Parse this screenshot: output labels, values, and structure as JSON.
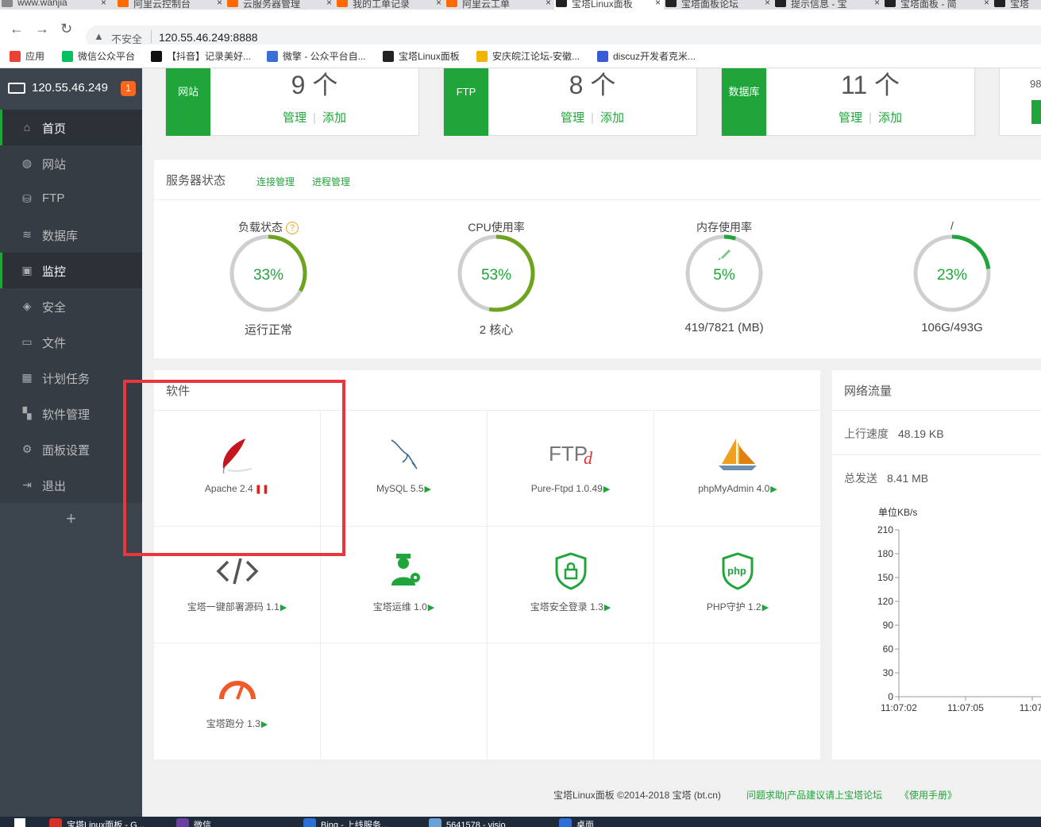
{
  "browser": {
    "tabs": [
      {
        "label": "www.wanjia",
        "close": "×",
        "active": false,
        "color": "#888888"
      },
      {
        "label": "阿里云控制台",
        "close": "×",
        "active": false,
        "color": "#ff6a00"
      },
      {
        "label": "云服务器管理",
        "close": "×",
        "active": false,
        "color": "#ff6a00"
      },
      {
        "label": "我的工单记录",
        "close": "×",
        "active": false,
        "color": "#ff6a00"
      },
      {
        "label": "阿里云工单",
        "close": "×",
        "active": false,
        "color": "#ff6a00"
      },
      {
        "label": "宝塔Linux面板",
        "close": "×",
        "active": true,
        "color": "#222222"
      },
      {
        "label": "宝塔面板论坛",
        "close": "×",
        "active": false,
        "color": "#222222"
      },
      {
        "label": "提示信息 - 宝",
        "close": "×",
        "active": false,
        "color": "#222222"
      },
      {
        "label": "宝塔面板 - 简",
        "close": "×",
        "active": false,
        "color": "#222222"
      },
      {
        "label": "宝塔",
        "close": "",
        "active": false,
        "color": "#222222"
      }
    ],
    "nav": {
      "back": "←",
      "forward": "→",
      "reload": "↻"
    },
    "address": {
      "warning_icon": "▲",
      "insecure": "不安全",
      "url": "120.55.46.249:8888"
    },
    "bookmarks": [
      {
        "label": "应用",
        "color": "#ea4335"
      },
      {
        "label": "微信公众平台",
        "color": "#07c160"
      },
      {
        "label": "【抖音】记录美好...",
        "color": "#111111"
      },
      {
        "label": "微擎 - 公众平台自...",
        "color": "#3a6fd8"
      },
      {
        "label": "宝塔Linux面板",
        "color": "#222222"
      },
      {
        "label": "安庆皖江论坛-安徽...",
        "color": "#f3b400"
      },
      {
        "label": "discuz开发者克米...",
        "color": "#3a5bd8"
      }
    ]
  },
  "sidebar": {
    "ip": "120.55.46.249",
    "badge": "1",
    "items": [
      {
        "label": "首页",
        "icon": "⌂",
        "active": true
      },
      {
        "label": "网站",
        "icon": "◍",
        "active": false
      },
      {
        "label": "FTP",
        "icon": "⛁",
        "active": false
      },
      {
        "label": "数据库",
        "icon": "≋",
        "active": false
      },
      {
        "label": "监控",
        "icon": "▣",
        "active": false,
        "current": true
      },
      {
        "label": "安全",
        "icon": "◈",
        "active": false
      },
      {
        "label": "文件",
        "icon": "▭",
        "active": false
      },
      {
        "label": "计划任务",
        "icon": "▦",
        "active": false
      },
      {
        "label": "软件管理",
        "icon": "▚",
        "active": false
      },
      {
        "label": "面板设置",
        "icon": "⚙",
        "active": false
      },
      {
        "label": "退出",
        "icon": "⇥",
        "active": false
      }
    ],
    "plus": "+"
  },
  "stats": [
    {
      "label": "网站",
      "value": "9 个",
      "manage": "管理",
      "add": "添加"
    },
    {
      "label": "FTP",
      "value": "8 个",
      "manage": "管理",
      "add": "添加"
    },
    {
      "label": "数据库",
      "value": "11 个",
      "manage": "管理",
      "add": "添加"
    },
    {
      "label": "",
      "value": "98",
      "manage": "",
      "add": ""
    }
  ],
  "server_status": {
    "title": "服务器状态",
    "links": [
      "连接管理",
      "进程管理"
    ],
    "gauges": [
      {
        "title": "负载状态",
        "help": "?",
        "value": "33%",
        "sub": "运行正常",
        "percent": 33,
        "color": "#6ea31e"
      },
      {
        "title": "CPU使用率",
        "value": "53%",
        "sub": "2 核心",
        "percent": 53,
        "color": "#6ea31e"
      },
      {
        "title": "内存使用率",
        "value": "5%",
        "sub": "419/7821 (MB)",
        "percent": 5,
        "color": "#20a53a",
        "rocket": true
      },
      {
        "title": "/",
        "value": "23%",
        "sub": "106G/493G",
        "percent": 23,
        "color": "#20a53a"
      }
    ]
  },
  "software": {
    "title": "软件",
    "items": [
      {
        "name": "Apache 2.4",
        "status": "pause",
        "icon": "apache-feather-icon"
      },
      {
        "name": "MySQL 5.5",
        "status": "play",
        "icon": "mysql-dolphin-icon"
      },
      {
        "name": "Pure-Ftpd 1.0.49",
        "status": "play",
        "icon": "ftpd-icon"
      },
      {
        "name": "phpMyAdmin 4.0",
        "status": "play",
        "icon": "phpmyadmin-sailboat-icon"
      },
      {
        "name": "宝塔一键部署源码 1.1",
        "status": "play",
        "icon": "code-icon"
      },
      {
        "name": "宝塔运维 1.0",
        "status": "play",
        "icon": "ops-person-icon"
      },
      {
        "name": "宝塔安全登录 1.3",
        "status": "play",
        "icon": "secure-login-shield-icon"
      },
      {
        "name": "PHP守护 1.2",
        "status": "play",
        "icon": "php-shield-icon"
      },
      {
        "name": "宝塔跑分 1.3",
        "status": "play",
        "icon": "speedometer-icon"
      }
    ],
    "play_glyph": "▶",
    "pause_glyph": "❚❚"
  },
  "network": {
    "title": "网络流量",
    "upload_label": "上行速度",
    "upload_value": "48.19 KB",
    "sent_label": "总发送",
    "sent_value": "8.41 MB"
  },
  "chart_data": {
    "type": "line",
    "title": "",
    "ylabel": "单位KB/s",
    "xlabel": "",
    "ylim": [
      0,
      210
    ],
    "yticks": [
      0,
      30,
      60,
      90,
      120,
      150,
      180,
      210
    ],
    "categories": [
      "11:07:02",
      "11:07:05",
      "11:07:"
    ],
    "series": []
  },
  "footer": {
    "copyright": "宝塔Linux面板 ©2014-2018 宝塔 (bt.cn)",
    "forum_link": "问题求助|产品建议请上宝塔论坛",
    "manual_link": "《使用手册》"
  },
  "taskbar": [
    {
      "label": "宝塔Linux面板 - G...",
      "color": "#d93025"
    },
    {
      "label": "微信",
      "color": "#6b3fa0"
    },
    {
      "label": "Bing - 上线服务...",
      "color": "#2b6fd8"
    },
    {
      "label": "5641578 - visio",
      "color": "#6aa0d8"
    },
    {
      "label": "桌面",
      "color": "#2b6fd8"
    }
  ],
  "colors": {
    "brand": "#20a53a",
    "sidebar": "#3c444d",
    "highlight": "#e8383d"
  }
}
